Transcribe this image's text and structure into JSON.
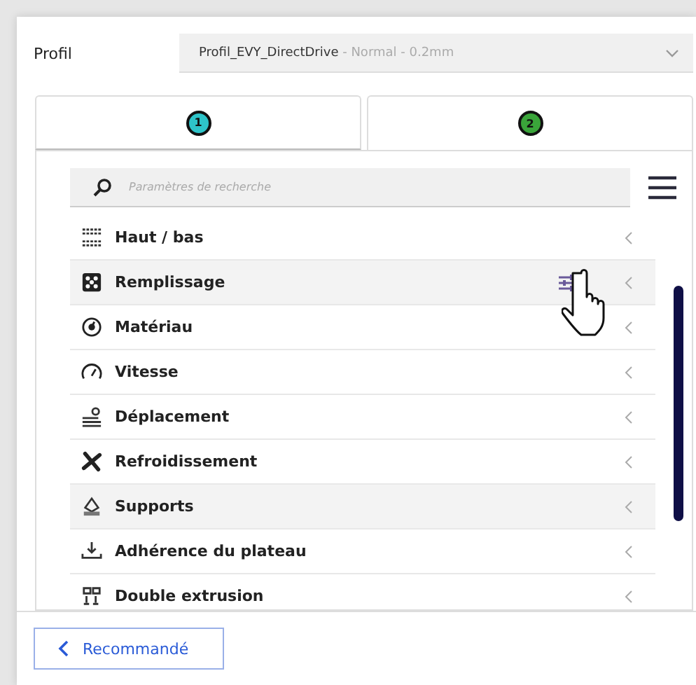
{
  "profile": {
    "label": "Profil",
    "value": "Profil_EVY_DirectDrive",
    "detail": " - Normal - 0.2mm"
  },
  "tabs": [
    {
      "label": "1",
      "color": "#2ec4c9",
      "selected": false
    },
    {
      "label": "2",
      "color": "#3aa53a",
      "selected": true
    }
  ],
  "search": {
    "placeholder": "Paramètres de recherche"
  },
  "categories": [
    {
      "label": "Haut / bas",
      "highlighted": false
    },
    {
      "label": "Remplissage",
      "highlighted": true
    },
    {
      "label": "Matériau",
      "highlighted": false
    },
    {
      "label": "Vitesse",
      "highlighted": false
    },
    {
      "label": "Déplacement",
      "highlighted": false
    },
    {
      "label": "Refroidissement",
      "highlighted": false
    },
    {
      "label": "Supports",
      "highlighted": true
    },
    {
      "label": "Adhérence du plateau",
      "highlighted": false
    },
    {
      "label": "Double extrusion",
      "highlighted": false
    }
  ],
  "footer": {
    "button": "Recommandé"
  }
}
